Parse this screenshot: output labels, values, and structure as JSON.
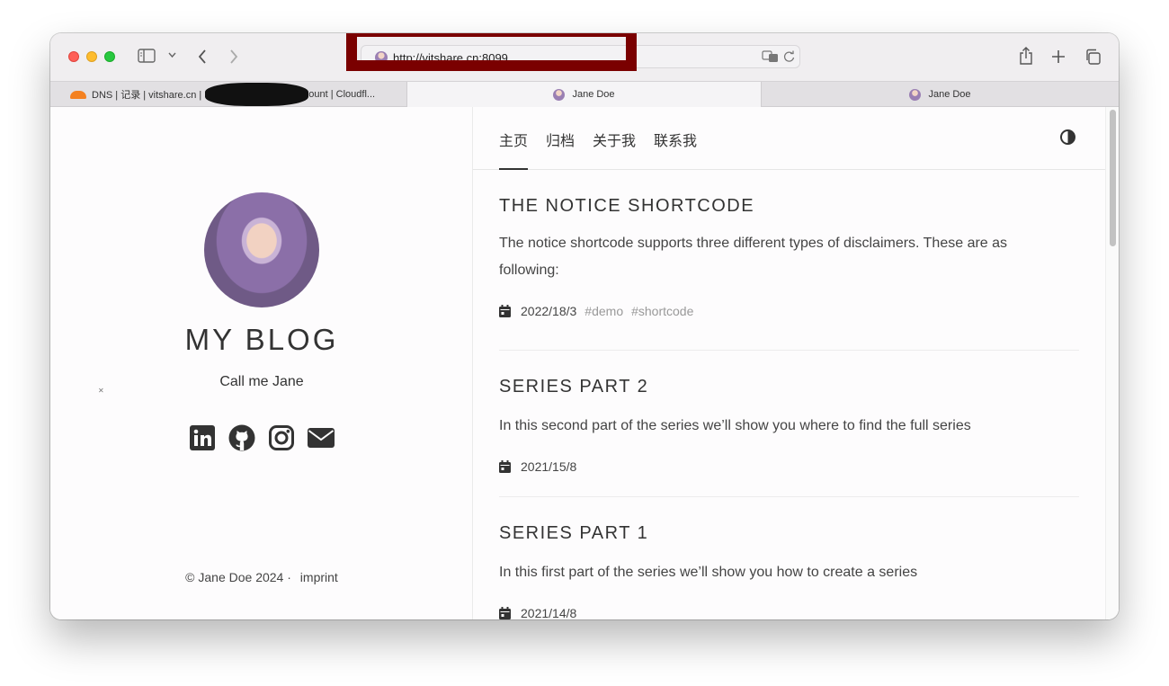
{
  "browser": {
    "url": "http://vitshare.cn:8099",
    "tabs": [
      {
        "label": "DNS | 记录 | vitshare.cn |",
        "label_tail": "ccount | Cloudfl..."
      },
      {
        "label": "Jane Doe"
      },
      {
        "label": "Jane Doe"
      }
    ]
  },
  "sidebar": {
    "title": "MY BLOG",
    "subtitle": "Call me Jane",
    "social_icons": [
      "linkedin-icon",
      "github-icon",
      "instagram-icon",
      "email-icon"
    ],
    "footer_copyright": "© Jane Doe 2024 ·",
    "footer_link": "imprint"
  },
  "nav": {
    "items": [
      "主页",
      "归档",
      "关于我",
      "联系我"
    ],
    "active_index": 0
  },
  "posts": [
    {
      "title": "THE NOTICE SHORTCODE",
      "summary_line1": "The notice shortcode supports three different types of disclaimers. These are as",
      "summary_line2": "following:",
      "date": "2022/18/3",
      "tags": [
        "#demo",
        "#shortcode"
      ]
    },
    {
      "title": "SERIES PART 2",
      "summary": "In this second part of the series we’ll show you where to find the full series",
      "date": "2021/15/8"
    },
    {
      "title": "SERIES PART 1",
      "summary": "In this first part of the series we’ll show you how to create a series",
      "date": "2021/14/8"
    }
  ],
  "colors": {
    "highlight_box": "#7a0000",
    "text": "#333333",
    "tag": "#999999"
  }
}
